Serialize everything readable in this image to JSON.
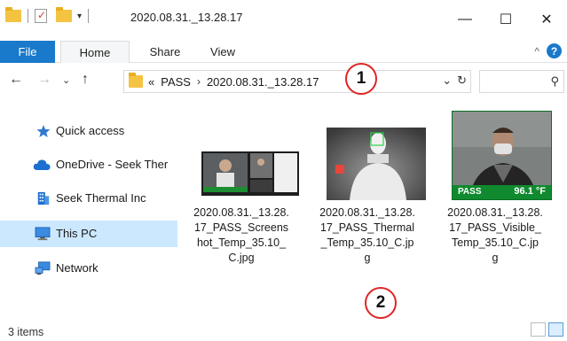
{
  "window": {
    "title": "2020.08.31._13.28.17",
    "minimize": "—",
    "maximize": "☐",
    "close": "✕"
  },
  "ribbon": {
    "tabs": [
      "File",
      "Home",
      "Share",
      "View"
    ],
    "expand_icon": "^",
    "help": "?"
  },
  "address_bar": {
    "overflow": "«",
    "crumbs": [
      "PASS",
      "2020.08.31._13.28.17"
    ],
    "crumb_separator": "›"
  },
  "callouts": [
    "1",
    "2"
  ],
  "nav_pane": {
    "items": [
      {
        "label": "Quick access",
        "icon": "star-icon"
      },
      {
        "label": "OneDrive - Seek Ther",
        "icon": "cloud-icon"
      },
      {
        "label": "Seek Thermal Inc",
        "icon": "building-icon"
      },
      {
        "label": "This PC",
        "icon": "monitor-icon",
        "selected": true
      },
      {
        "label": "Network",
        "icon": "network-icon"
      }
    ]
  },
  "files": [
    {
      "name_lines": [
        "2020.08.31._13.28.",
        "17_PASS_Screens",
        "hot_Temp_35.10_",
        "C.jpg"
      ],
      "thumb": "screenshot"
    },
    {
      "name_lines": [
        "2020.08.31._13.28.",
        "17_PASS_Thermal",
        "_Temp_35.10_C.jp",
        "g"
      ],
      "thumb": "thermal"
    },
    {
      "name_lines": [
        "2020.08.31._13.28.",
        "17_PASS_Visible_",
        "Temp_35.10_C.jp",
        "g"
      ],
      "thumb": "visible",
      "badge_pass": "PASS",
      "badge_temp": "96.1 °F"
    }
  ],
  "thumb_badges": {
    "pass": "PASS",
    "temp": "96.1 °F"
  },
  "status": {
    "item_count": "3 items"
  },
  "colors": {
    "accent": "#1979ca",
    "selected": "#cce8ff",
    "callout": "#e02424",
    "folder": "#f5c342",
    "pass_green": "#2bb24c"
  }
}
